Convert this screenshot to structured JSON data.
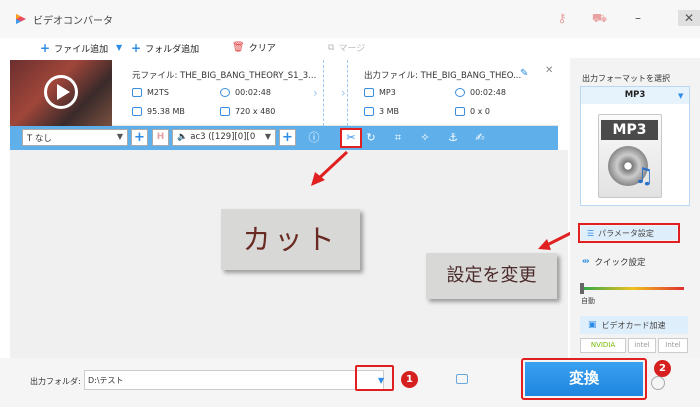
{
  "titlebar": {
    "title": "ビデオコンバータ"
  },
  "toolbar": {
    "add_file": "ファイル追加",
    "add_folder": "フォルダ追加",
    "clear": "クリア",
    "merge": "マージ"
  },
  "file": {
    "source_name": "元ファイル: THE_BIG_BANG_THEORY_S1_3...",
    "source_format": "M2TS",
    "source_duration": "00:02:48",
    "source_size": "95.38 MB",
    "source_resolution": "720 x 480",
    "output_name": "出力ファイル: THE_BIG_BANG_THEO...",
    "output_format": "MP3",
    "output_duration": "00:02:48",
    "output_size": "3 MB",
    "output_resolution": "0 x 0"
  },
  "editbar": {
    "subtitle": "なし",
    "audio_track": "ac3 ([129][0][0"
  },
  "annotations": {
    "cut": "カット",
    "change_settings": "設定を変更",
    "step1": "1",
    "step2": "2"
  },
  "bottom": {
    "output_folder_label": "出力フォルダ:",
    "output_folder_value": "D:\\テスト",
    "convert": "変換"
  },
  "right_panel": {
    "title": "出力フォーマットを選択",
    "format": "MP3",
    "format_badge": "MP3",
    "parameter_settings": "パラメータ設定",
    "quick_settings": "クイック設定",
    "auto": "自動",
    "gpu_accel": "ビデオカード加速",
    "vendors": [
      "NVIDIA",
      "intel",
      "Intel"
    ]
  },
  "colors": {
    "accent": "#2d8ce6",
    "editbar": "#5fb0ea",
    "highlight_red": "#e02020",
    "callout_bg": "#d8d8d6"
  }
}
